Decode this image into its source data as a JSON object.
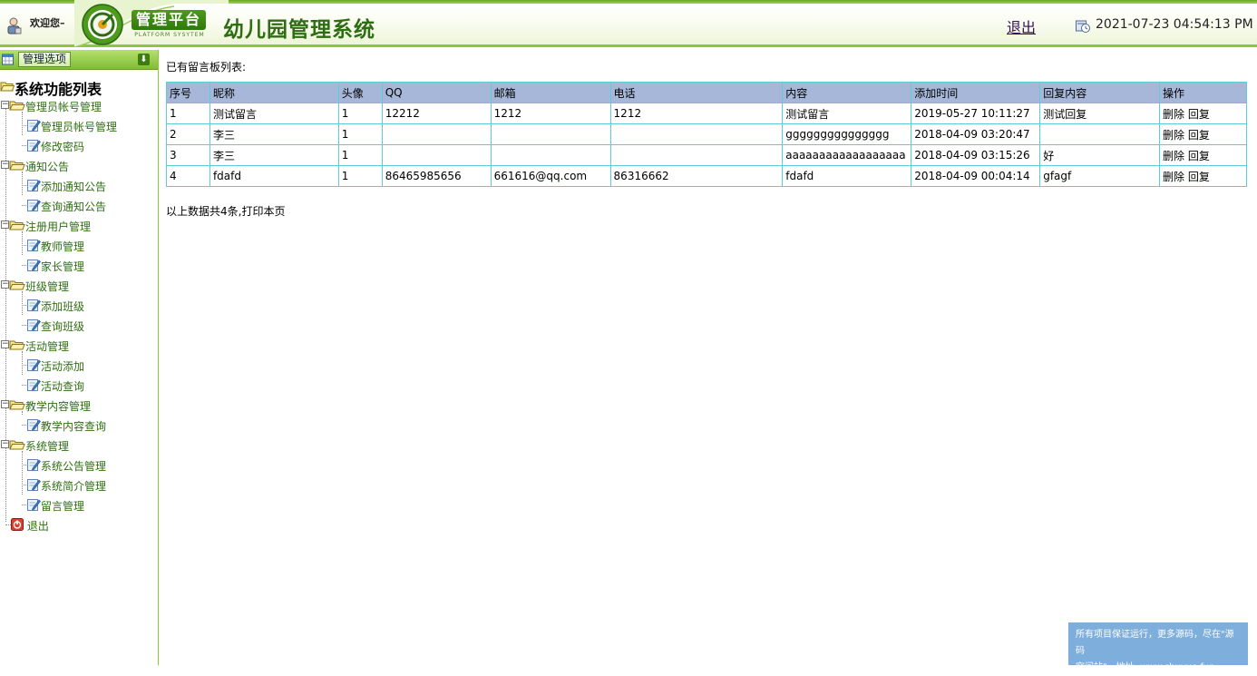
{
  "header": {
    "welcome": "欢迎您–",
    "badge": "管理平台",
    "badge_sub": "PLATFORM SYSYTEM",
    "title": "幼儿园管理系统",
    "logout": "退出",
    "datetime": "2021-07-23 04:54:13 PM"
  },
  "sidebar": {
    "bar_label": "管理选项",
    "root": "系统功能列表",
    "groups": [
      {
        "label": "管理员帐号管理",
        "items": [
          "管理员帐号管理",
          "修改密码"
        ]
      },
      {
        "label": "通知公告",
        "items": [
          "添加通知公告",
          "查询通知公告"
        ]
      },
      {
        "label": "注册用户管理",
        "items": [
          "教师管理",
          "家长管理"
        ]
      },
      {
        "label": "班级管理",
        "items": [
          "添加班级",
          "查询班级"
        ]
      },
      {
        "label": "活动管理",
        "items": [
          "活动添加",
          "活动查询"
        ]
      },
      {
        "label": "教学内容管理",
        "items": [
          "教学内容查询"
        ]
      },
      {
        "label": "系统管理",
        "items": [
          "系统公告管理",
          "系统简介管理",
          "留言管理"
        ]
      }
    ],
    "exit": "退出"
  },
  "main": {
    "heading": "已有留言板列表:",
    "columns": [
      "序号",
      "昵称",
      "头像",
      "QQ",
      "邮箱",
      "电话",
      "内容",
      "添加时间",
      "回复内容",
      "操作"
    ],
    "rows": [
      [
        "1",
        "测试留言",
        "1",
        "12212",
        "1212",
        "1212",
        "测试留言",
        "2019-05-27 10:11:27",
        "测试回复"
      ],
      [
        "2",
        "李三",
        "1",
        "",
        "",
        "",
        "ggggggggggggggg",
        "2018-04-09 03:20:47",
        ""
      ],
      [
        "3",
        "李三",
        "1",
        "",
        "",
        "",
        "aaaaaaaaaaaaaaaaaa",
        "2018-04-09 03:15:26",
        "好"
      ],
      [
        "4",
        "fdafd",
        "1",
        "86465985656",
        "661616@qq.com",
        "86316662",
        "fdafd",
        "2018-04-09 00:04:14",
        "gfagf"
      ]
    ],
    "actions": {
      "delete": "删除",
      "reply": "回复"
    },
    "summary": "以上数据共4条,打印本页",
    "footer_note": [
      "所有项目保证运行，更多源码，尽在\"源码",
      "空间站\"，地址: www.shuyue.fun"
    ]
  }
}
